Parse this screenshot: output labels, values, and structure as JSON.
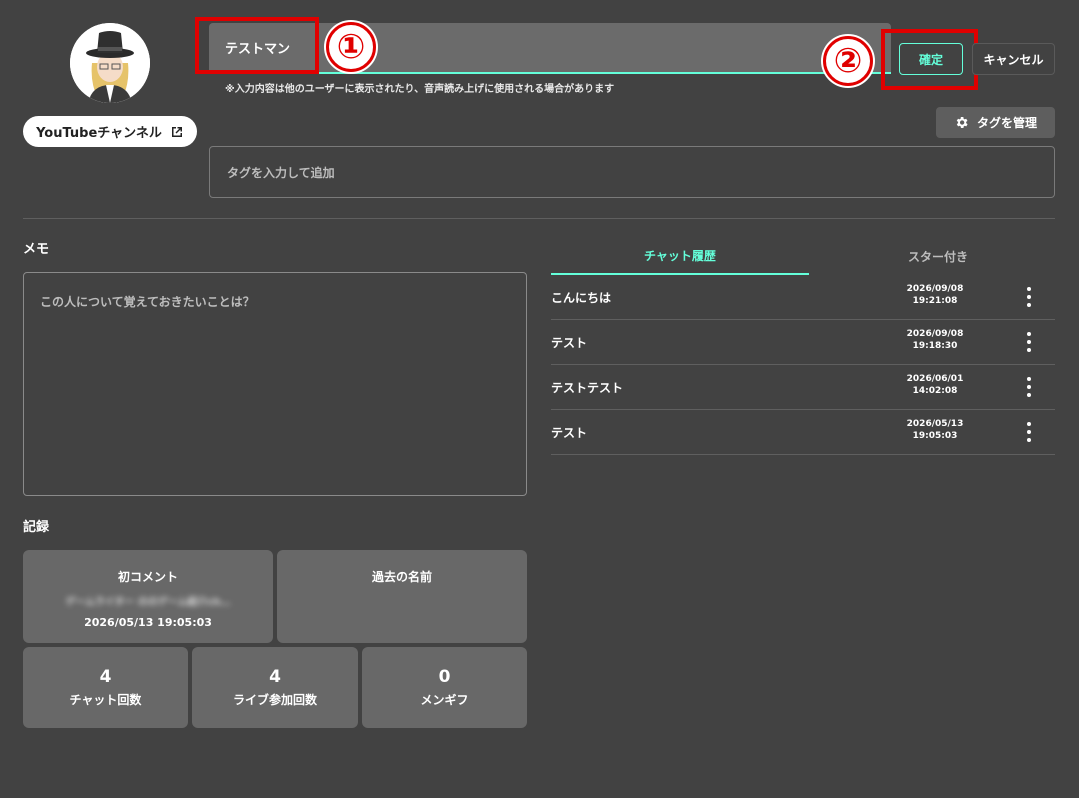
{
  "profile": {
    "youtube_label": "YouTubeチャンネル",
    "name_value": "テストマン",
    "name_hint": "※入力内容は他のユーザーに表示されたり、音声読み上げに使用される場合があります",
    "confirm_label": "確定",
    "cancel_label": "キャンセル"
  },
  "annotations": {
    "marker_1": "①",
    "marker_2": "②",
    "marker_color": "#e00000"
  },
  "tags": {
    "manage_label": "タグを管理",
    "input_placeholder": "タグを入力して追加"
  },
  "memo": {
    "label": "メモ",
    "placeholder": "この人について覚えておきたいことは？"
  },
  "tabs": [
    {
      "label": "チャット履歴",
      "active": true
    },
    {
      "label": "スター付き",
      "active": false
    }
  ],
  "chat_history": [
    {
      "text": "こんにちは",
      "date": "2026/09/08",
      "time": "19:21:08"
    },
    {
      "text": "テスト",
      "date": "2026/09/08",
      "time": "19:18:30"
    },
    {
      "text": "テストテスト",
      "date": "2026/06/01",
      "time": "14:02:08"
    },
    {
      "text": "テスト",
      "date": "2026/05/13",
      "time": "19:05:03"
    }
  ],
  "records": {
    "label": "記録",
    "first_comment_title": "初コメント",
    "first_comment_text": "ゲームライター ののゲーム紹介ch…",
    "first_comment_date": "2026/05/13 19:05:03",
    "past_names_title": "過去の名前",
    "stats": [
      {
        "value": "4",
        "label": "チャット回数"
      },
      {
        "value": "4",
        "label": "ライブ参加回数"
      },
      {
        "value": "0",
        "label": "メンギフ"
      }
    ]
  },
  "colors": {
    "background": "#424242",
    "accent": "#64ffda",
    "card": "#686868"
  },
  "icons": {
    "external": "external-link-icon",
    "gear": "gear-icon",
    "more": "more-vert-icon"
  }
}
